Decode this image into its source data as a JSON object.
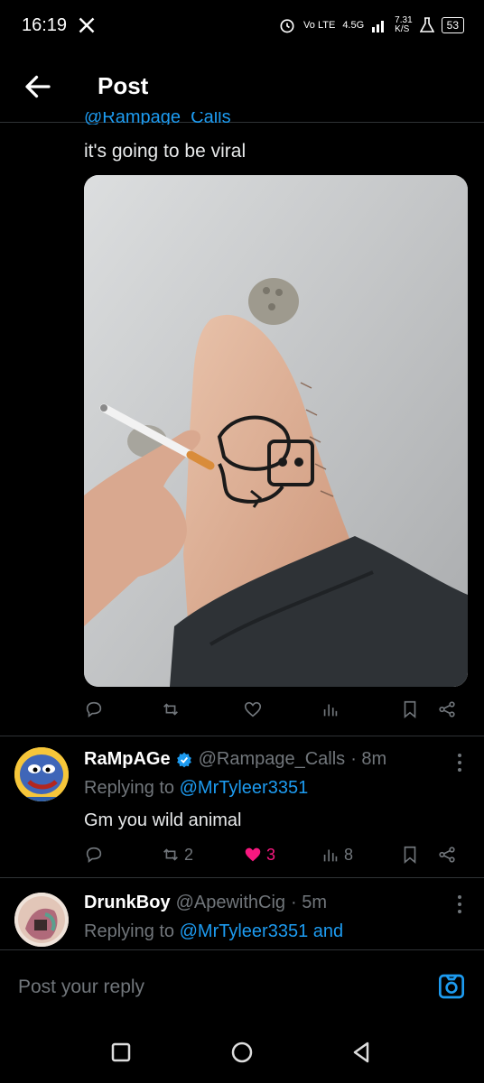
{
  "status_bar": {
    "time": "16:19",
    "network_label": "4.5G",
    "volte_label": "Vo LTE",
    "speed_value": "7.31",
    "speed_unit": "K/S",
    "battery": "53"
  },
  "header": {
    "title": "Post"
  },
  "post": {
    "cutoff_handle": "@Rampage_Calls",
    "text": "it's going to be viral",
    "media_alt": "photo of leg tattoo with cigarette",
    "actions": {
      "reply": "",
      "repost": "",
      "like": "",
      "views": "",
      "bookmark": "",
      "share": ""
    }
  },
  "replies": [
    {
      "display_name": "RaMpAGe",
      "verified": true,
      "handle": "@Rampage_Calls",
      "time": "· 8m",
      "replying_prefix": "Replying to ",
      "replying_to": "@MrTyleer3351",
      "text": "Gm you wild animal",
      "stats": {
        "replies": "",
        "reposts": "2",
        "likes": "3",
        "views": "8"
      },
      "liked": true
    },
    {
      "display_name": "DrunkBoy",
      "verified": false,
      "handle": "@ApewithCig",
      "time": "· 5m",
      "replying_prefix": "Replying to ",
      "replying_to": "@MrTyleer3351 and",
      "text": ""
    }
  ],
  "composer": {
    "placeholder": "Post your reply"
  },
  "colors": {
    "accent": "#1d9bf0",
    "like": "#f91880",
    "muted": "#71767b",
    "border": "#2f3336"
  }
}
